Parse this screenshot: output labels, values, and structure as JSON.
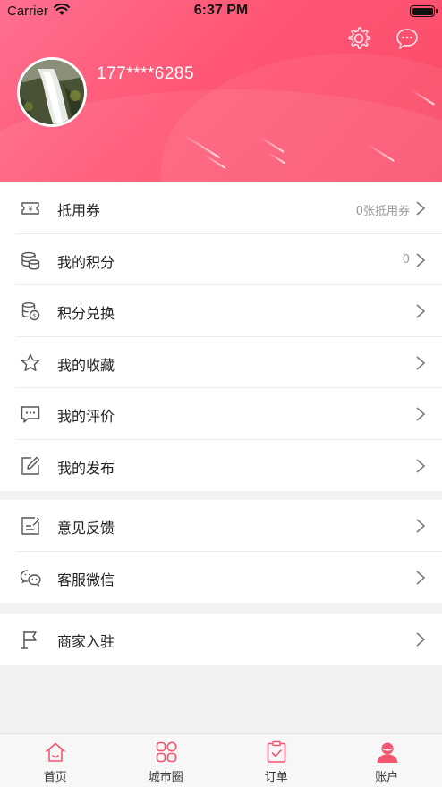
{
  "status_bar": {
    "carrier": "Carrier",
    "time": "6:37 PM"
  },
  "header": {
    "phone": "177****6285",
    "settings_icon": "gear-icon",
    "message_icon": "chat-bubble-icon"
  },
  "theme": {
    "accent": "#ff5675",
    "tab_active": "#f5556f"
  },
  "menu_group_1": [
    {
      "label": "抵用券",
      "value": "0张抵用券",
      "icon": "coupon-icon"
    },
    {
      "label": "我的积分",
      "value": "0",
      "icon": "coins-icon"
    },
    {
      "label": "积分兑换",
      "value": "",
      "icon": "coins-exchange-icon"
    },
    {
      "label": "我的收藏",
      "value": "",
      "icon": "star-icon"
    },
    {
      "label": "我的评价",
      "value": "",
      "icon": "comment-icon"
    },
    {
      "label": "我的发布",
      "value": "",
      "icon": "edit-icon"
    }
  ],
  "menu_group_2": [
    {
      "label": "意见反馈",
      "value": "",
      "icon": "feedback-icon"
    },
    {
      "label": "客服微信",
      "value": "",
      "icon": "wechat-icon"
    }
  ],
  "menu_group_3": [
    {
      "label": "商家入驻",
      "value": "",
      "icon": "flag-icon"
    }
  ],
  "tabbar": [
    {
      "label": "首页",
      "icon": "home-icon"
    },
    {
      "label": "城市圈",
      "icon": "grid-icon"
    },
    {
      "label": "订单",
      "icon": "clipboard-check-icon"
    },
    {
      "label": "账户",
      "icon": "user-icon",
      "active": true
    }
  ]
}
